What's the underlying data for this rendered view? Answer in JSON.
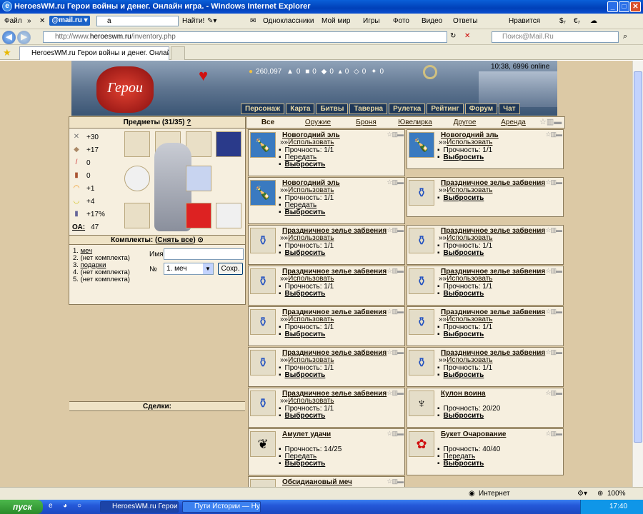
{
  "window": {
    "title": "HeroesWM.ru Герои войны и денег. Онлайн игра. - Windows Internet Explorer"
  },
  "toolbar1": {
    "file_menu": "Файл",
    "search_value": "а",
    "find_button": "Найти!",
    "items": [
      "Одноклассники",
      "Мой мир",
      "Игры",
      "Фото",
      "Видео",
      "Ответы"
    ],
    "like": "Нравится",
    "currency1": "$₇",
    "currency2": "€₇"
  },
  "address": {
    "url_prefix": "http://www.",
    "url_domain": "heroeswm.ru",
    "url_path": "/inventory.php",
    "search_placeholder": "Поиск@Mail.Ru"
  },
  "tab": {
    "title": "HeroesWM.ru Герои войны и денег. Онлайн игра."
  },
  "game": {
    "clock": "10:38, 6996 online",
    "gold": "260,097",
    "resources": [
      "0",
      "0",
      "0",
      "0",
      "0",
      "0"
    ],
    "logo_text": "Герои",
    "menu": [
      "Персонаж",
      "Карта",
      "Битвы",
      "Таверна",
      "Рулетка",
      "Рейтинг",
      "Форум",
      "Чат"
    ]
  },
  "inventory": {
    "header": "Предметы (31/35)",
    "help": "?",
    "stats": [
      {
        "icon": "attack-icon",
        "value": "+30"
      },
      {
        "icon": "defense-icon",
        "value": "+17"
      },
      {
        "icon": "spellpower-icon",
        "value": "0"
      },
      {
        "icon": "knowledge-icon",
        "value": "0"
      },
      {
        "icon": "luck-icon",
        "value": "+1"
      },
      {
        "icon": "morale-icon",
        "value": "+4"
      },
      {
        "icon": "initiative-icon",
        "value": "+17%"
      }
    ],
    "oa_label": "ОА:",
    "oa_value": "47",
    "sets_header": "Комплекты:",
    "sets_remove": "Снять все",
    "sets": [
      {
        "num": "1.",
        "name": "меч",
        "link": true
      },
      {
        "num": "2.",
        "name": "(нет комплекта)",
        "link": false
      },
      {
        "num": "3.",
        "name": "подарки",
        "link": true
      },
      {
        "num": "4.",
        "name": "(нет комплекта)",
        "link": false
      },
      {
        "num": "5.",
        "name": "(нет комплекта)",
        "link": false
      }
    ],
    "name_label": "Имя",
    "name_value": "",
    "num_label": "№",
    "num_value": "1. меч",
    "save_button": "Сохр.",
    "deals_header": "Сделки:"
  },
  "categories": [
    "Все",
    "Оружие",
    "Броня",
    "Ювелирка",
    "Другое",
    "Аренда"
  ],
  "item_actions": {
    "use": "Использовать",
    "use_prefix": "»»",
    "transfer": "Передать",
    "drop": "Выбросить",
    "durability_label": "Прочность:"
  },
  "items": [
    {
      "name": "Новогодний эль",
      "durability": "1/1",
      "usable": true,
      "transfer": true,
      "icon": "ale-bottle-icon"
    },
    {
      "name": "Новогодний эль",
      "durability": "1/1",
      "usable": true,
      "transfer": false,
      "icon": "ale-bottle-icon"
    },
    {
      "name": "Новогодний эль",
      "durability": "1/1",
      "usable": true,
      "transfer": true,
      "icon": "ale-bottle-icon"
    },
    {
      "name": "Праздничное зелье забвения",
      "durability": "",
      "usable": true,
      "transfer": false,
      "icon": "potion-icon"
    },
    {
      "name": "Праздничное зелье забвения",
      "durability": "1/1",
      "usable": true,
      "transfer": false,
      "icon": "potion-icon"
    },
    {
      "name": "Праздничное зелье забвения",
      "durability": "1/1",
      "usable": true,
      "transfer": false,
      "icon": "potion-icon"
    },
    {
      "name": "Праздничное зелье забвения",
      "durability": "1/1",
      "usable": true,
      "transfer": false,
      "icon": "potion-icon"
    },
    {
      "name": "Праздничное зелье забвения",
      "durability": "1/1",
      "usable": true,
      "transfer": false,
      "icon": "potion-icon"
    },
    {
      "name": "Праздничное зелье забвения",
      "durability": "1/1",
      "usable": true,
      "transfer": false,
      "icon": "potion-icon"
    },
    {
      "name": "Праздничное зелье забвения",
      "durability": "1/1",
      "usable": true,
      "transfer": false,
      "icon": "potion-icon"
    },
    {
      "name": "Праздничное зелье забвения",
      "durability": "1/1",
      "usable": true,
      "transfer": false,
      "icon": "potion-icon"
    },
    {
      "name": "Праздничное зелье забвения",
      "durability": "1/1",
      "usable": true,
      "transfer": false,
      "icon": "potion-icon"
    },
    {
      "name": "Праздничное зелье забвения",
      "durability": "1/1",
      "usable": true,
      "transfer": false,
      "icon": "potion-icon"
    },
    {
      "name": "Кулон воина",
      "durability": "20/20",
      "usable": false,
      "transfer": false,
      "icon": "pendant-icon"
    },
    {
      "name": "Амулет удачи",
      "durability": "14/25",
      "usable": false,
      "transfer": true,
      "icon": "amulet-icon"
    },
    {
      "name": "Букет Очарование",
      "durability": "40/40",
      "usable": false,
      "transfer": true,
      "icon": "bouquet-icon"
    },
    {
      "name": "Обсидиановый меч",
      "durability": "",
      "usable": false,
      "transfer": false,
      "icon": "sword-icon"
    }
  ],
  "statusbar": {
    "zone": "Интернет",
    "zoom": "100%"
  },
  "taskbar": {
    "start": "пуск",
    "tasks": [
      "HeroesWM.ru Герои ...",
      "Пути Истории — Ну..."
    ],
    "lang": "RU",
    "time": "17:40"
  }
}
